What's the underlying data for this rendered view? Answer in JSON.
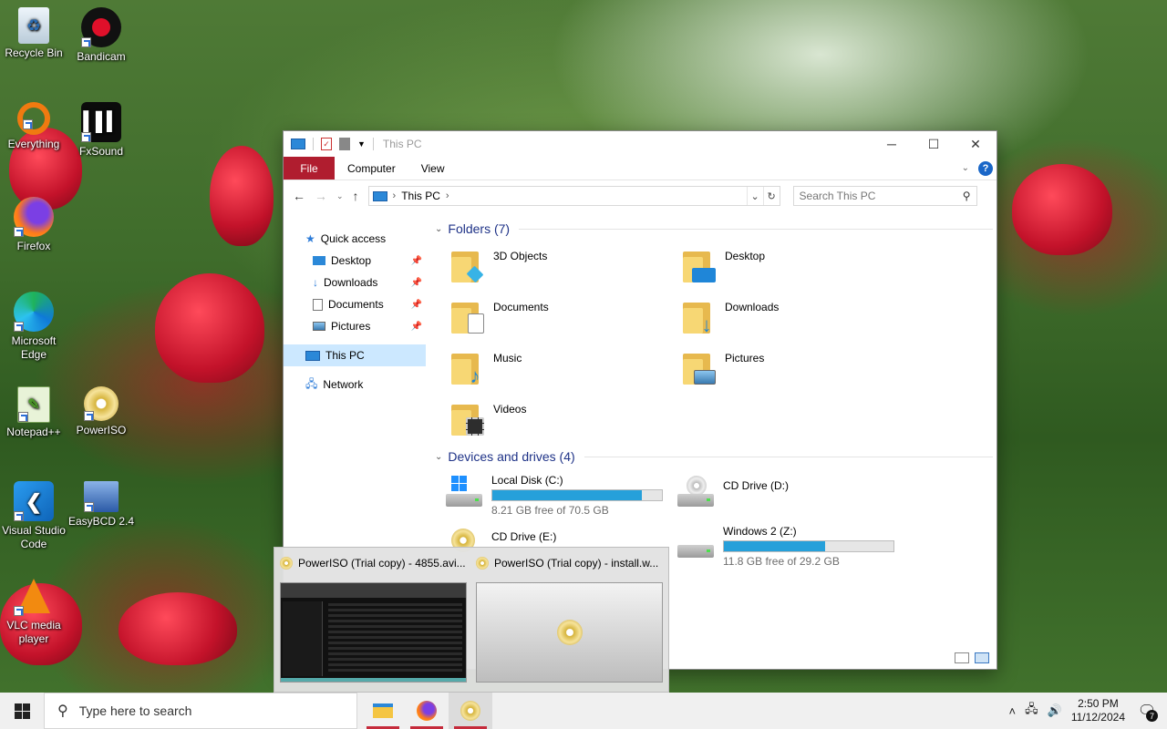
{
  "desktop": {
    "icons": [
      {
        "label": "Recycle Bin"
      },
      {
        "label": "Bandicam"
      },
      {
        "label": "Everything"
      },
      {
        "label": "FxSound"
      },
      {
        "label": "Firefox"
      },
      {
        "label": "Microsoft Edge"
      },
      {
        "label": "Notepad++"
      },
      {
        "label": "PowerISO"
      },
      {
        "label": "Visual Studio Code"
      },
      {
        "label": "EasyBCD 2.4"
      },
      {
        "label": "VLC media player"
      }
    ]
  },
  "window": {
    "title": "This PC",
    "ribbon_tabs": [
      "File",
      "Computer",
      "View"
    ],
    "address": {
      "path": "This PC"
    },
    "search_placeholder": "Search This PC",
    "nav": {
      "quick_access": "Quick access",
      "quick_items": [
        "Desktop",
        "Downloads",
        "Documents",
        "Pictures"
      ],
      "this_pc": "This PC",
      "network": "Network"
    },
    "folders_header": "Folders (7)",
    "folders": [
      "3D Objects",
      "Desktop",
      "Documents",
      "Downloads",
      "Music",
      "Pictures",
      "Videos"
    ],
    "drives_header": "Devices and drives (4)",
    "drives": [
      {
        "name": "Local Disk (C:)",
        "free_text": "8.21 GB free of 70.5 GB",
        "used_fraction": 0.884
      },
      {
        "name": "CD Drive (D:)"
      },
      {
        "name": "CD Drive (E:)"
      },
      {
        "name": "Windows 2 (Z:)",
        "free_text": "11.8 GB free of 29.2 GB",
        "used_fraction": 0.596
      }
    ]
  },
  "taskbar_previews": [
    {
      "title": "PowerISO (Trial copy) - 4855.avi..."
    },
    {
      "title": "PowerISO (Trial copy) - install.w..."
    }
  ],
  "taskbar": {
    "search_placeholder": "Type here to search",
    "time": "2:50 PM",
    "date": "11/12/2024",
    "notification_count": "7",
    "accent": "#c52b3b"
  }
}
